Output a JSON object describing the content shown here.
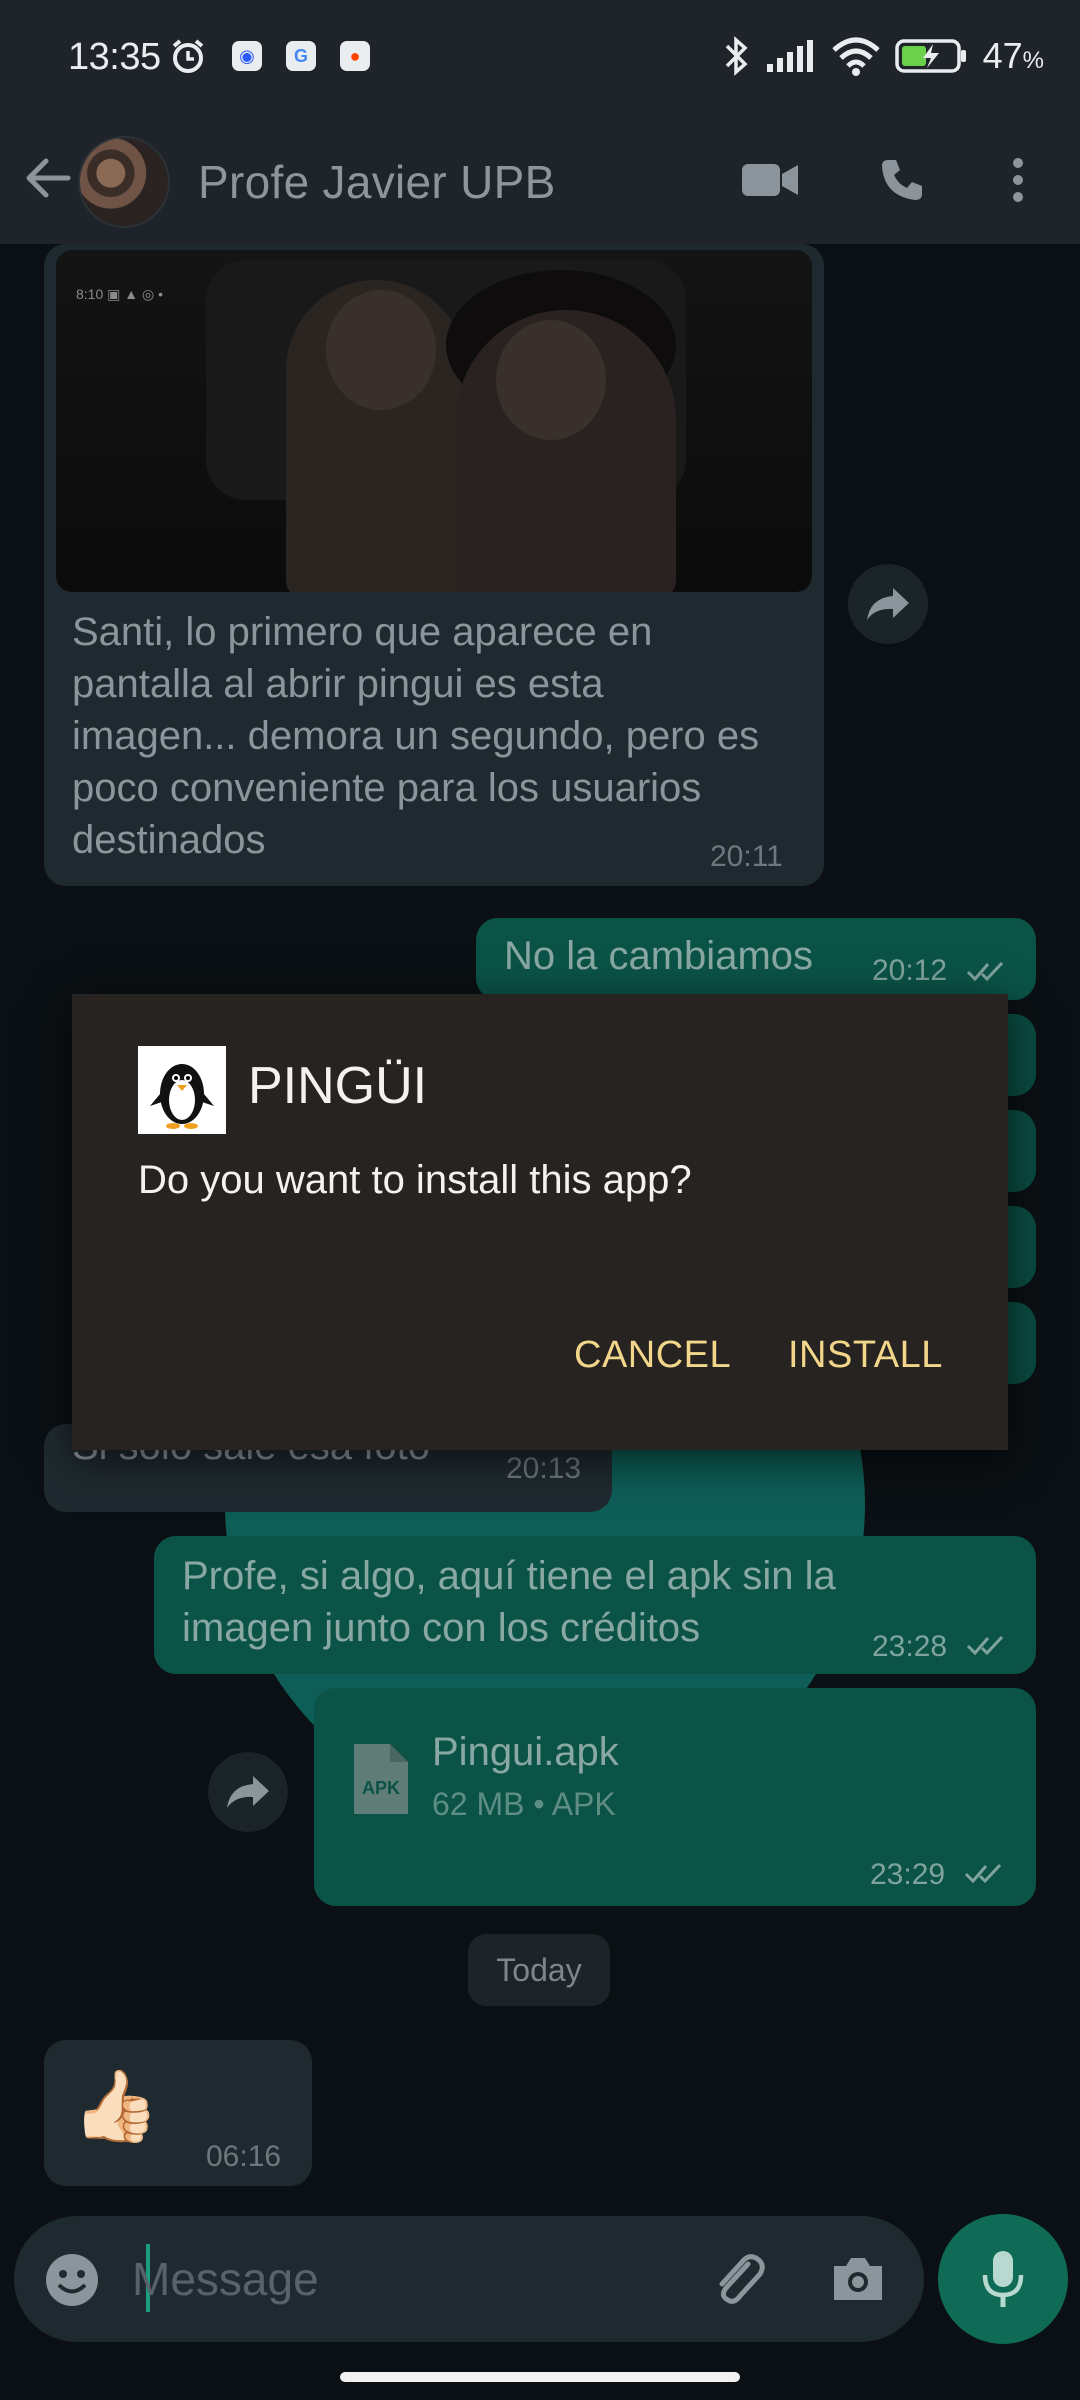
{
  "status_bar": {
    "time": "13:35",
    "battery_value": "47",
    "battery_unit": "%"
  },
  "header": {
    "contact_name": "Profe Javier UPB"
  },
  "messages": [
    {
      "id": "m1",
      "dir": "in",
      "type": "image",
      "caption": "Santi, lo primero que aparece en pantalla al abrir pingui es esta imagen... demora un segundo, pero es poco conveniente para los usuarios destinados",
      "time": "20:11"
    },
    {
      "id": "m2",
      "dir": "out",
      "text": "No la cambiamos",
      "time": "20:12"
    },
    {
      "id": "m3",
      "dir": "in",
      "text": "Si solo sale esa foto",
      "time": "20:13"
    },
    {
      "id": "m4",
      "dir": "out",
      "text": "Profe, si algo, aquí tiene el apk sin la imagen junto con los créditos",
      "time": "23:28"
    },
    {
      "id": "m5",
      "dir": "out",
      "type": "file",
      "file_name": "Pingui.apk",
      "file_meta": "62 MB • APK",
      "file_badge": "APK",
      "time": "23:29"
    },
    {
      "id": "m6",
      "dir": "in",
      "type": "emoji",
      "emoji": "👍🏻",
      "time": "06:16"
    }
  ],
  "date_separator": "Today",
  "photo_overlay_text": "8:10 ▣ ▲ ◎ •",
  "composer": {
    "placeholder": "Message"
  },
  "dialog": {
    "app_name": "PINGÜI",
    "question": "Do you want to install this app?",
    "cancel_label": "CANCEL",
    "install_label": "INSTALL"
  },
  "colors": {
    "accent": "#0f6b55",
    "dialog_button": "#f2d68a",
    "outgoing_bubble": "#0b5347",
    "incoming_bubble": "#1f2a30"
  }
}
